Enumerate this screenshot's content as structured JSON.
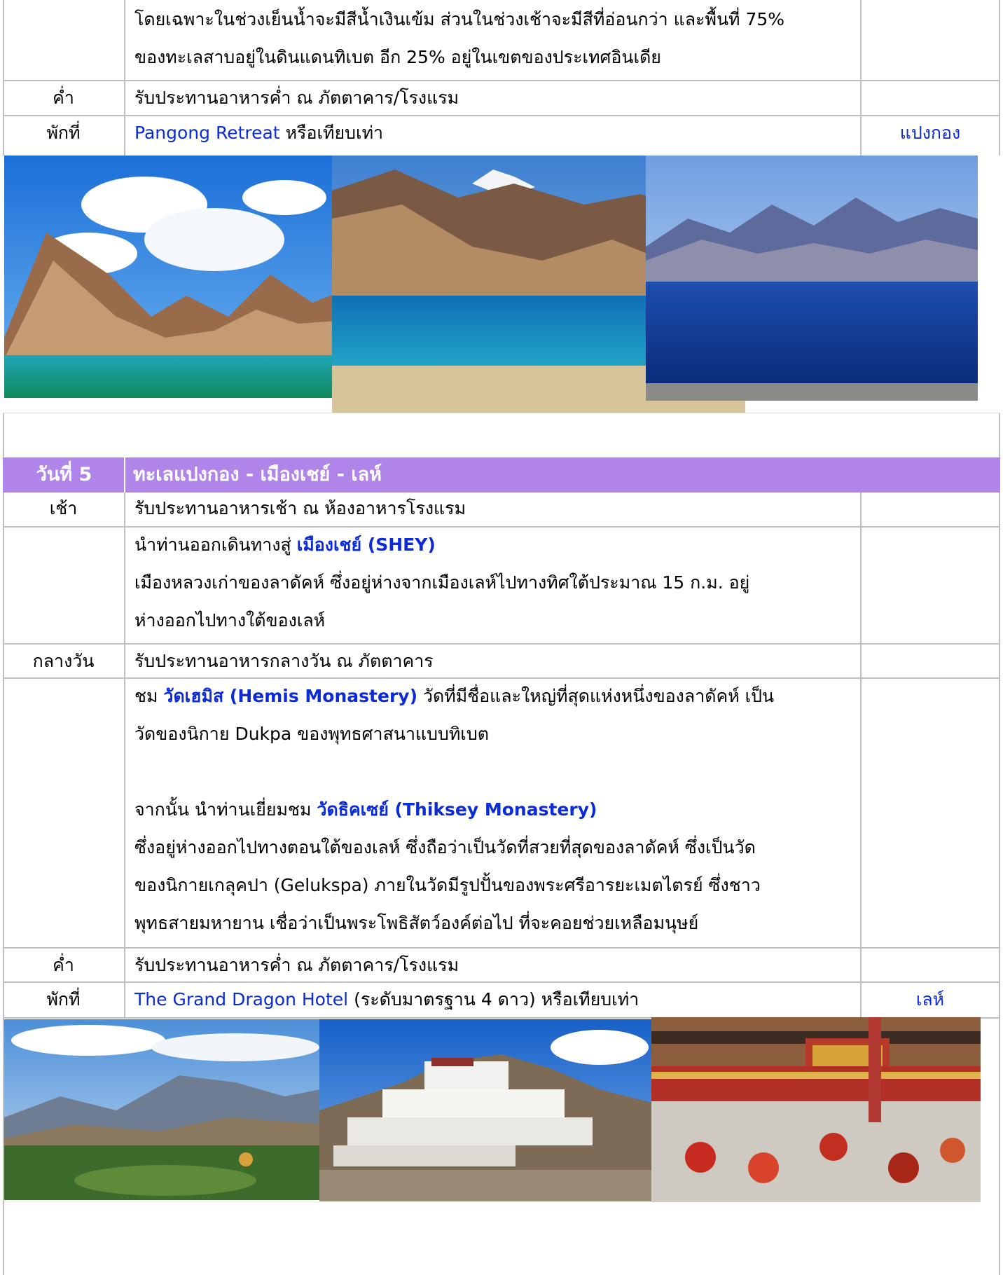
{
  "top_block": {
    "intro_line1": "โดยเฉพาะในช่วงเย็นน้ำจะมีสีน้ำเงินเข้ม ส่วนในช่วงเช้าจะมีสีที่อ่อนกว่า และพื้นที่ 75%",
    "intro_line2": "ของทะเลสาบอยู่ในดินแดนทิเบต อีก 25% อยู่ในเขตของประเทศอินเดีย",
    "dinner_label": "ค่ำ",
    "dinner_text": "รับประทานอาหารค่ำ ณ ภัตตาคาร/โรงแรม",
    "stay_label": "พักที่",
    "stay_hotel": "Pangong Retreat",
    "stay_suffix": "หรือเทียบเท่า",
    "stay_location": "แปงกอง"
  },
  "day5": {
    "day_label": "วันที่ 5",
    "day_title": "ทะเลแปงกอง - เมืองเชย์ - เลห์",
    "breakfast_label": "เช้า",
    "breakfast_text": "รับประทานอาหารเช้า ณ ห้องอาหารโรงแรม",
    "shey_prefix": "นำท่านออกเดินทางสู่",
    "shey_name": "เมืองเชย์ (SHEY)",
    "shey_desc1": "เมืองหลวงเก่าของลาดัคห์ ซึ่งอยู่ห่างจากเมืองเลห์ไปทางทิศใต้ประมาณ 15 ก.ม. อยู่",
    "shey_desc2": "ห่างออกไปทางใต้ของเลห์",
    "lunch_label": "กลางวัน",
    "lunch_text": "รับประทานอาหารกลางวัน ณ ภัตตาคาร",
    "hemis_prefix": "ชม",
    "hemis_name": "วัดเฮมิส (Hemis Monastery)",
    "hemis_desc1": "วัดที่มีชื่อและใหญ่ที่สุดแห่งหนึ่งของลาดัคห์ เป็น",
    "hemis_desc2": "วัดของนิกาย Dukpa ของพุทธศาสนาแบบทิเบต",
    "thiksey_prefix": "จากนั้น นำท่านเยี่ยมชม",
    "thiksey_name": "วัดธิคเซย์ (Thiksey Monastery)",
    "thiksey_desc1": "ซึ่งอยู่ห่างออกไปทางตอนใต้ของเลห์ ซึ่งถือว่าเป็นวัดที่สวยที่สุดของลาดัคห์ ซึ่งเป็นวัด",
    "thiksey_desc2": "ของนิกายเกลุคปา (Gelukspa)   ภายในวัดมีรูปปั้นของพระศรีอารยะเมตไตรย์ ซึ่งชาว",
    "thiksey_desc3": "พุทธสายมหายาน เชื่อว่าเป็นพระโพธิสัตว์องค์ต่อไป ที่จะคอยช่วยเหลือมนุษย์",
    "dinner_label": "ค่ำ",
    "dinner_text": "รับประทานอาหารค่ำ ณ ภัตตาคาร/โรงแรม",
    "stay_label": "พักที่",
    "stay_hotel": "The Grand Dragon Hotel",
    "stay_suffix": "(ระดับมาตรฐาน 4 ดาว) หรือเทียบเท่า",
    "stay_location": "เลห์"
  },
  "colors": {
    "day_band": "#b085e9",
    "link_blue": "#0b2bd8",
    "grid": "#bfbfbf"
  }
}
